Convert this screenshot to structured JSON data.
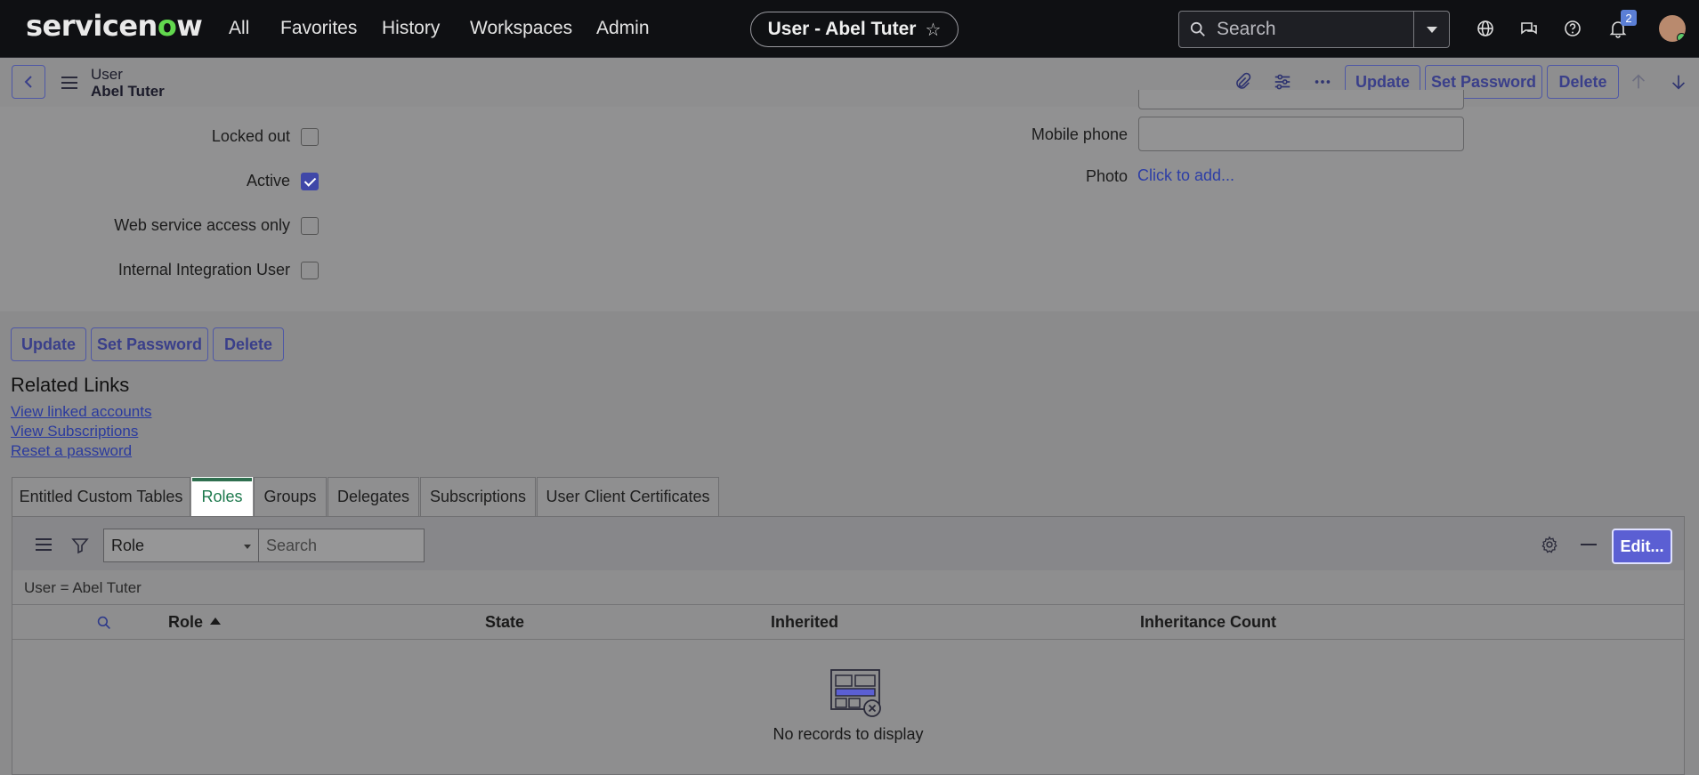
{
  "topnav": {
    "logo_text": "servicenow",
    "items": [
      "All",
      "Favorites",
      "History",
      "Workspaces",
      "Admin"
    ],
    "record_title": "User - Abel Tuter",
    "search_placeholder": "Search",
    "notification_count": "2"
  },
  "formbar": {
    "table_label": "User",
    "record_name": "Abel Tuter",
    "buttons": [
      "Update",
      "Set Password",
      "Delete"
    ]
  },
  "form": {
    "fields": [
      "Locked out",
      "Active",
      "Web service access only",
      "Internal Integration User"
    ],
    "active_checked": true,
    "mobile_phone_label": "Mobile phone",
    "mobile_phone_value": "",
    "photo_label": "Photo",
    "photo_link": "Click to add..."
  },
  "bottom_buttons": [
    "Update",
    "Set Password",
    "Delete"
  ],
  "related_links": {
    "title": "Related Links",
    "links": [
      "View linked accounts",
      "View Subscriptions",
      "Reset a password"
    ]
  },
  "tabs": [
    "Entitled Custom Tables",
    "Roles",
    "Groups",
    "Delegates",
    "Subscriptions",
    "User Client Certificates"
  ],
  "active_tab": "Roles",
  "list": {
    "filter_field": "Role",
    "search_placeholder": "Search",
    "edit_label": "Edit...",
    "breadcrumb": "User = Abel Tuter",
    "columns": [
      "Role",
      "State",
      "Inherited",
      "Inheritance Count"
    ],
    "sorted_column": "Role",
    "empty_message": "No records to display"
  },
  "colors": {
    "nav_bg": "#0f1013",
    "brand_green": "#62d84e",
    "button_border": "#4f58a6",
    "primary_button": "#5b5fd3",
    "active_tab_accent": "#2f6f4f"
  }
}
